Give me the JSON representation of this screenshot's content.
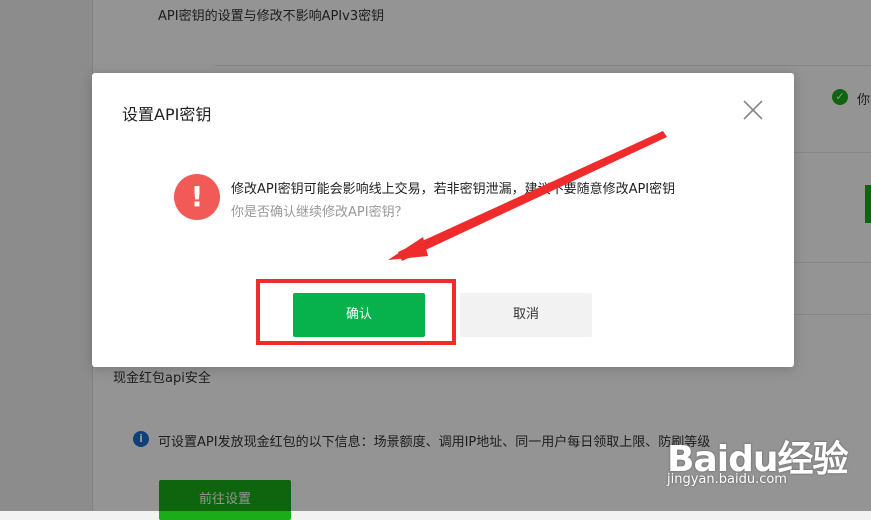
{
  "background": {
    "note": "API密钥的设置与修改不影响APIv3密钥",
    "status_text": "你",
    "section_title": "现金红包api安全",
    "info_text": "可设置API发放现金红包的以下信息：场景额度、调用IP地址、同一用户每日领取上限、防刷等级",
    "goto_button": "前往设置"
  },
  "dialog": {
    "title": "设置API密钥",
    "message": "修改API密钥可能会影响线上交易，若非密钥泄漏，建议不要随意修改API密钥",
    "sub_message": "你是否确认继续修改API密钥？",
    "confirm_label": "确认",
    "cancel_label": "取消",
    "warning_glyph": "!"
  },
  "watermark": {
    "brand": "Baidu经验",
    "url": "jingyan.baidu.com"
  },
  "colors": {
    "confirm": "#07b14b",
    "warning": "#f15a57",
    "annotation": "#ef2b2b",
    "overlay": "rgba(0,0,0,0.42)"
  },
  "icons": {
    "close": "close-icon",
    "warning": "exclamation-icon",
    "check": "check-icon",
    "info": "info-icon"
  }
}
